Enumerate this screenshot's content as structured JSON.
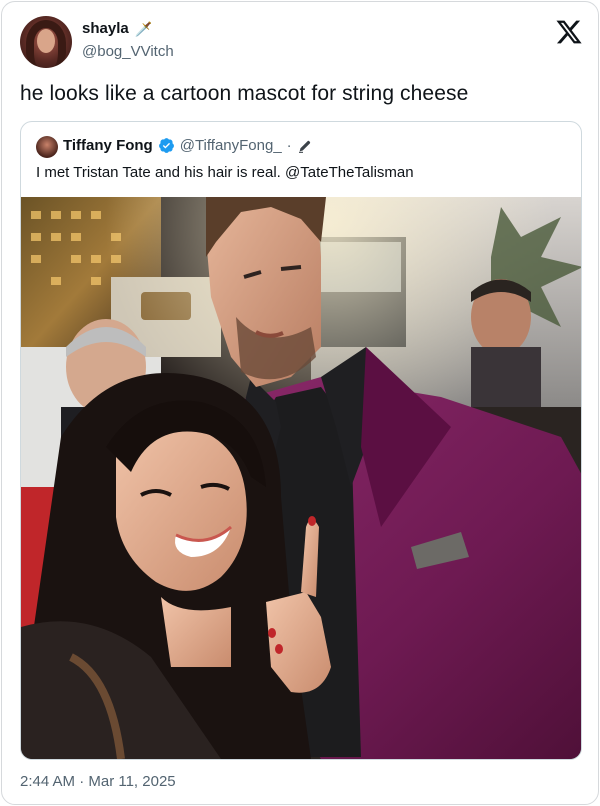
{
  "tweet": {
    "display_name": "shayla",
    "name_emoji": "🗡️",
    "handle": "@bog_VVitch",
    "text": "he looks like a cartoon mascot for string cheese",
    "timestamp": "2:44 AM · Mar 11, 2025"
  },
  "quoted_tweet": {
    "display_name": "Tiffany Fong",
    "handle": "@TiffanyFong_",
    "separator": "·",
    "text": "I met Tristan Tate and his hair is real. @TateTheTalisman"
  },
  "icons": {
    "brand": "x-logo-icon",
    "verified": "verified-badge-icon",
    "edited": "pencil-icon"
  },
  "colors": {
    "verified_blue": "#1d9bf0",
    "text_primary": "#0f1419",
    "text_secondary": "#536471",
    "blazer": "#7a1f5e"
  }
}
